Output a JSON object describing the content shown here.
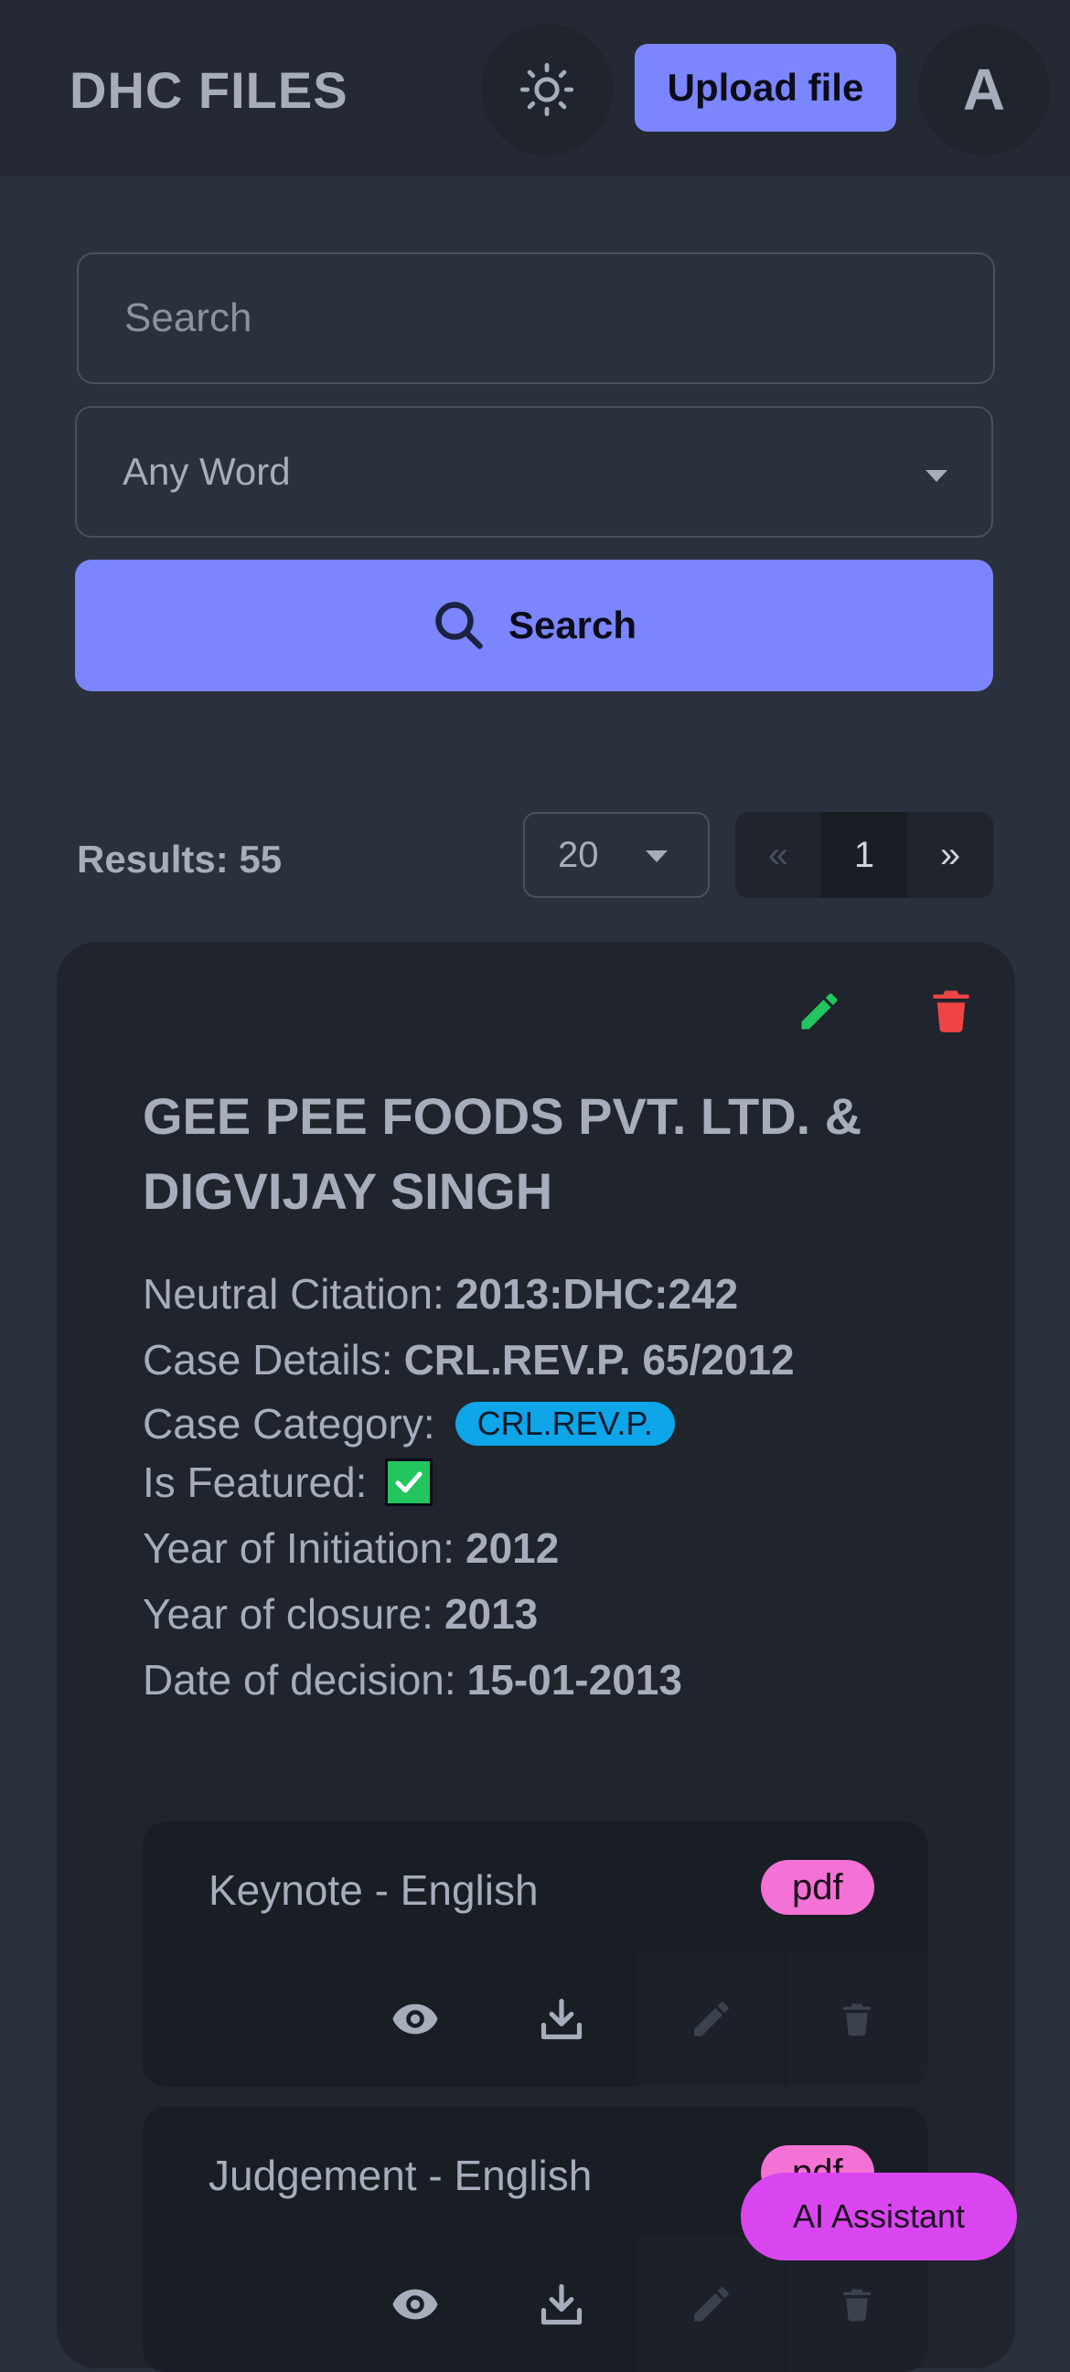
{
  "header": {
    "brand": "DHC FILES",
    "theme_icon": "sun-icon",
    "upload_label": "Upload file",
    "avatar_letter": "A"
  },
  "search": {
    "placeholder": "Search",
    "mode_value": "Any Word",
    "button_label": "Search",
    "button_icon": "search-icon"
  },
  "results": {
    "label": "Results: 55",
    "per_page": "20",
    "pager": {
      "prev": "«",
      "current": "1",
      "next": "»"
    }
  },
  "case": {
    "title": "GEE PEE FOODS PVT. LTD. & DIGVIJAY SINGH",
    "fields": {
      "neutral_citation_label": "Neutral Citation:",
      "neutral_citation": "2013:DHC:242",
      "case_details_label": "Case Details:",
      "case_details": "CRL.REV.P. 65/2012",
      "case_category_label": "Case Category:",
      "case_category": "CRL.REV.P.",
      "is_featured_label": "Is Featured:",
      "year_initiation_label": "Year of Initiation:",
      "year_initiation": "2012",
      "year_closure_label": "Year of closure:",
      "year_closure": "2013",
      "date_decision_label": "Date of decision:",
      "date_decision": "15-01-2013"
    },
    "files": [
      {
        "name": "Keynote - English",
        "type": "pdf"
      },
      {
        "name": "Judgement - English",
        "type": "pdf"
      }
    ]
  },
  "ai_assistant_label": "AI Assistant",
  "colors": {
    "primary": "#7b85fc",
    "edit": "#22c55e",
    "delete": "#ef4444",
    "category_badge": "#0ea5e9",
    "file_badge": "#f471d6",
    "ai_button": "#d946ef"
  }
}
